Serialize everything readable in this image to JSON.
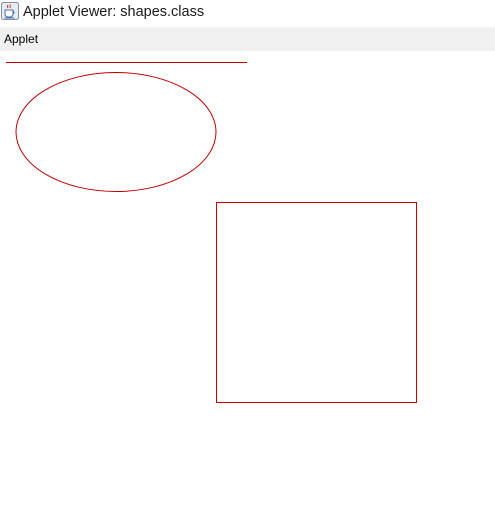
{
  "window": {
    "title": "Applet Viewer: shapes.class",
    "icon": "java-cup-icon"
  },
  "menubar": {
    "items": [
      {
        "label": "Applet"
      }
    ]
  },
  "applet": {
    "shape_color": "#c00000",
    "shapes": [
      "line",
      "oval",
      "rectangle"
    ]
  }
}
